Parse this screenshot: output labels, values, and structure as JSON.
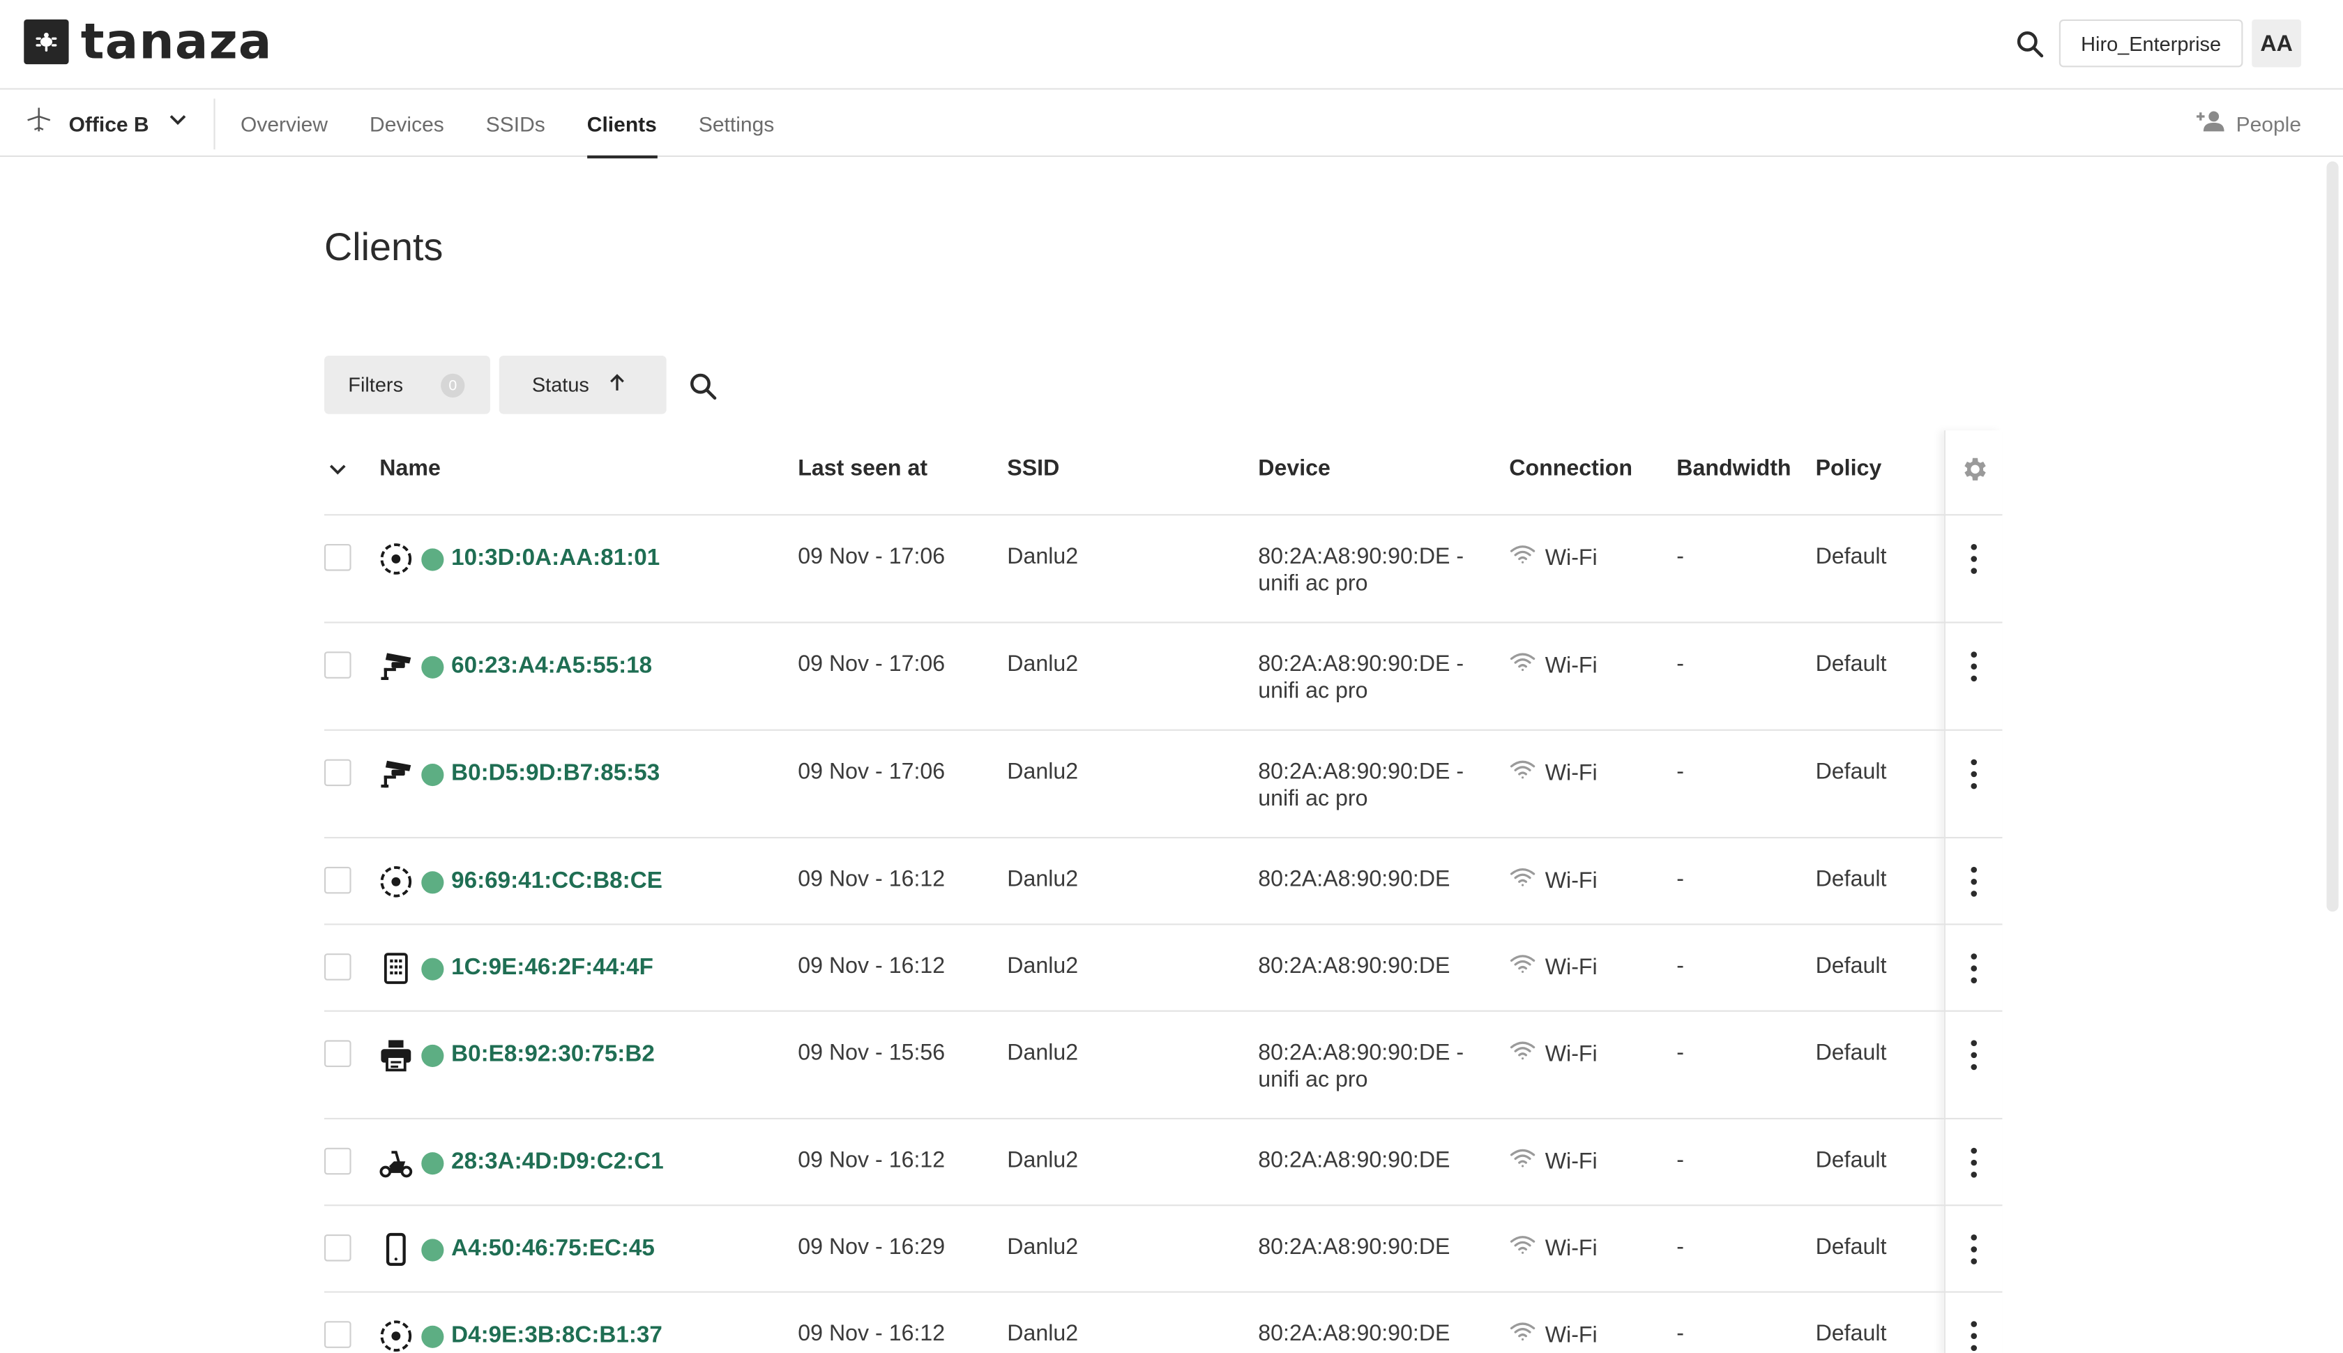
{
  "app": {
    "logo_text": "tanaza",
    "org_name": "Hiro_Enterprise",
    "avatar_initials": "AA"
  },
  "subnav": {
    "site": "Office B",
    "tabs": [
      {
        "label": "Overview"
      },
      {
        "label": "Devices"
      },
      {
        "label": "SSIDs"
      },
      {
        "label": "Clients"
      },
      {
        "label": "Settings"
      }
    ],
    "active_tab": "Clients",
    "people_label": "People"
  },
  "page": {
    "title": "Clients",
    "filters_label": "Filters",
    "filters_count": "0",
    "sort_label": "Status"
  },
  "table": {
    "columns": [
      "Name",
      "Last seen at",
      "SSID",
      "Device",
      "Connection",
      "Bandwidth",
      "Policy"
    ],
    "rows": [
      {
        "icon": "target-icon",
        "mac": "10:3D:0A:AA:81:01",
        "last_seen": "09 Nov - 17:06",
        "ssid": "Danlu2",
        "device_line1": "80:2A:A8:90:90:DE -",
        "device_line2": "unifi ac pro",
        "connection": "Wi-Fi",
        "bandwidth": "-",
        "policy": "Default"
      },
      {
        "icon": "security-camera-icon",
        "mac": "60:23:A4:A5:55:18",
        "last_seen": "09 Nov - 17:06",
        "ssid": "Danlu2",
        "device_line1": "80:2A:A8:90:90:DE -",
        "device_line2": "unifi ac pro",
        "connection": "Wi-Fi",
        "bandwidth": "-",
        "policy": "Default"
      },
      {
        "icon": "security-camera-icon",
        "mac": "B0:D5:9D:B7:85:53",
        "last_seen": "09 Nov - 17:06",
        "ssid": "Danlu2",
        "device_line1": "80:2A:A8:90:90:DE -",
        "device_line2": "unifi ac pro",
        "connection": "Wi-Fi",
        "bandwidth": "-",
        "policy": "Default"
      },
      {
        "icon": "target-icon",
        "mac": "96:69:41:CC:B8:CE",
        "last_seen": "09 Nov - 16:12",
        "ssid": "Danlu2",
        "device_line1": "80:2A:A8:90:90:DE",
        "device_line2": "",
        "connection": "Wi-Fi",
        "bandwidth": "-",
        "policy": "Default"
      },
      {
        "icon": "calculator-icon",
        "mac": "1C:9E:46:2F:44:4F",
        "last_seen": "09 Nov - 16:12",
        "ssid": "Danlu2",
        "device_line1": "80:2A:A8:90:90:DE",
        "device_line2": "",
        "connection": "Wi-Fi",
        "bandwidth": "-",
        "policy": "Default"
      },
      {
        "icon": "printer-icon",
        "mac": "B0:E8:92:30:75:B2",
        "last_seen": "09 Nov - 15:56",
        "ssid": "Danlu2",
        "device_line1": "80:2A:A8:90:90:DE -",
        "device_line2": "unifi ac pro",
        "connection": "Wi-Fi",
        "bandwidth": "-",
        "policy": "Default"
      },
      {
        "icon": "scooter-icon",
        "mac": "28:3A:4D:D9:C2:C1",
        "last_seen": "09 Nov - 16:12",
        "ssid": "Danlu2",
        "device_line1": "80:2A:A8:90:90:DE",
        "device_line2": "",
        "connection": "Wi-Fi",
        "bandwidth": "-",
        "policy": "Default"
      },
      {
        "icon": "smartphone-icon",
        "mac": "A4:50:46:75:EC:45",
        "last_seen": "09 Nov - 16:29",
        "ssid": "Danlu2",
        "device_line1": "80:2A:A8:90:90:DE",
        "device_line2": "",
        "connection": "Wi-Fi",
        "bandwidth": "-",
        "policy": "Default"
      },
      {
        "icon": "target-icon",
        "mac": "D4:9E:3B:8C:B1:37",
        "last_seen": "09 Nov - 16:12",
        "ssid": "Danlu2",
        "device_line1": "80:2A:A8:90:90:DE",
        "device_line2": "",
        "connection": "Wi-Fi",
        "bandwidth": "-",
        "policy": "Default"
      }
    ]
  },
  "colors": {
    "accent_mac": "#1f6e53",
    "status_online": "#5dae83",
    "logo": "#262626"
  }
}
